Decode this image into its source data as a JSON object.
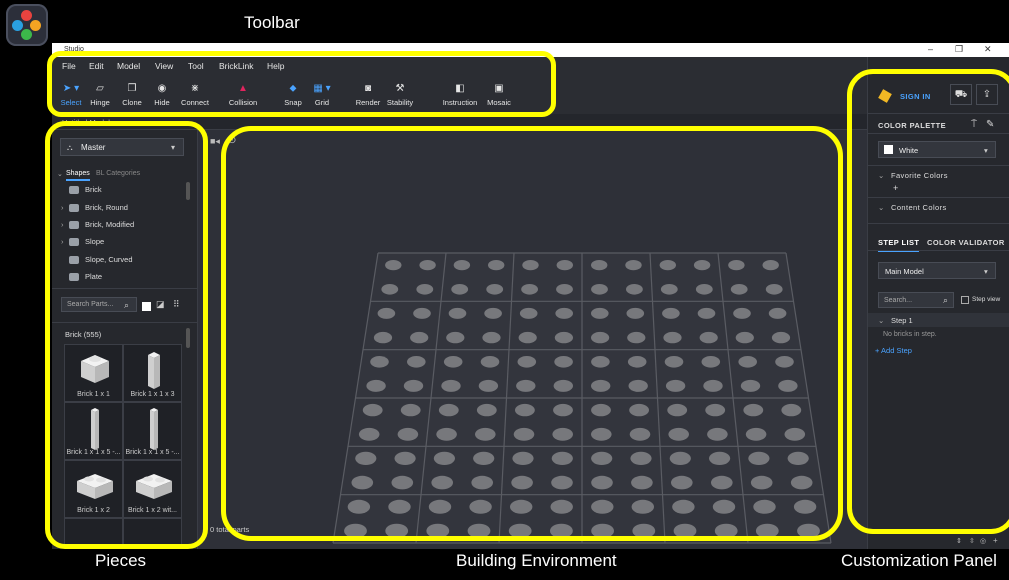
{
  "captions": {
    "toolbar": "Toolbar",
    "pieces": "Pieces",
    "building": "Building Environment",
    "customization": "Customization Panel"
  },
  "window": {
    "title": "Studio",
    "minimize": "–",
    "restore": "❐",
    "close": "✕"
  },
  "menu": [
    "File",
    "Edit",
    "Model",
    "View",
    "Tool",
    "BrickLink",
    "Help"
  ],
  "tools": {
    "select": "Select",
    "hinge": "Hinge",
    "clone": "Clone",
    "hide": "Hide",
    "connect": "Connect",
    "collision": "Collision",
    "snap": "Snap",
    "grid": "Grid",
    "render": "Render",
    "stability": "Stability",
    "instruction": "Instruction",
    "mosaic": "Mosaic"
  },
  "tab": {
    "label": "Untitled Model"
  },
  "left": {
    "master": "Master",
    "cat_shapes": "Shapes",
    "cat_bl": "BL Categories",
    "tree": [
      "Brick",
      "Brick, Round",
      "Brick, Modified",
      "Slope",
      "Slope, Curved",
      "Plate"
    ],
    "search_placeholder": "Search Parts...",
    "group": "Brick (555)",
    "parts": [
      "Brick 1 x 1",
      "Brick 1 x 1 x 3",
      "Brick 1 x 1 x 5 -...",
      "Brick 1 x 1 x 5 -...",
      "Brick 1 x 2",
      "Brick 1 x 2 wit..."
    ]
  },
  "canvas": {
    "total_parts": "0 total parts"
  },
  "right": {
    "sign_in": "SIGN IN",
    "color_palette": "COLOR PALETTE",
    "color_selected": "White",
    "favorite_colors": "Favorite Colors",
    "add_symbol": "+",
    "content_colors": "Content Colors",
    "tab_step_list": "STEP LIST",
    "tab_color_validator": "COLOR VALIDATOR",
    "model_selected": "Main Model",
    "search_placeholder": "Search...",
    "step_view": "Step view",
    "step1": "Step 1",
    "no_bricks": "No bricks in step.",
    "add_step": "+ Add Step"
  },
  "colors": {
    "highlight": "#ffff00",
    "accent_blue": "#4aa3ff",
    "collision_red": "#e0245e",
    "sign_in_gold": "#f2b824",
    "stud": "#77787c",
    "plate_line": "#5a5c63"
  }
}
